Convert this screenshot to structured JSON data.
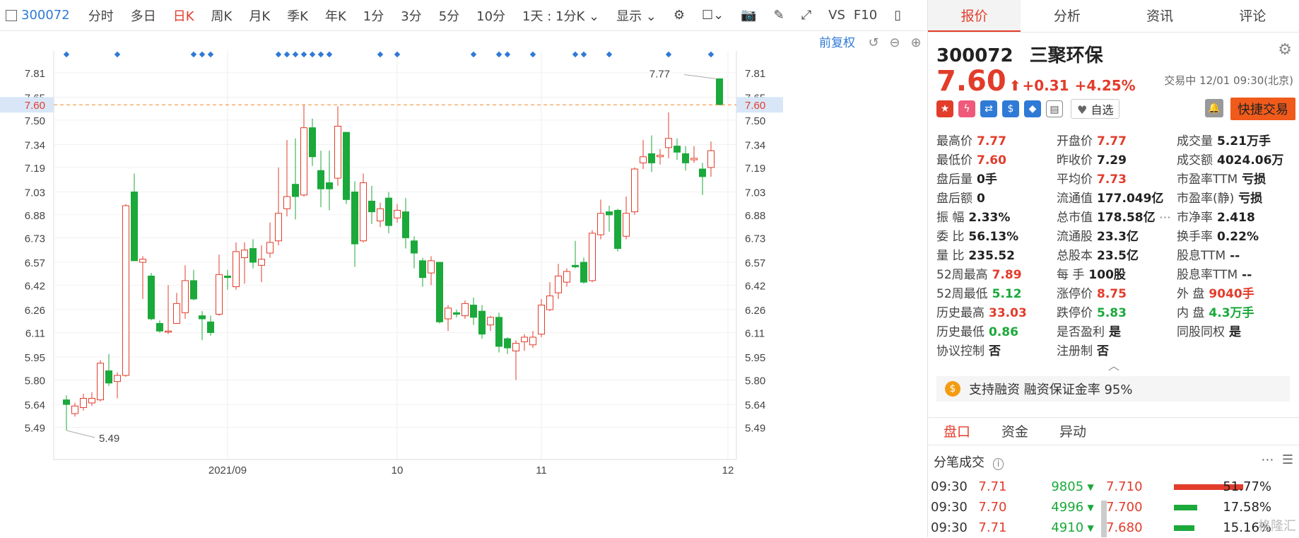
{
  "toolbar": {
    "code": "300072",
    "tabs": [
      "分时",
      "多日",
      "日K",
      "周K",
      "月K",
      "季K",
      "年K",
      "1分",
      "3分",
      "5分",
      "10分"
    ],
    "active_tab": "日K",
    "interval": "1天 : 1分K",
    "display": "显示",
    "vs": "VS",
    "f10": "F10"
  },
  "chart": {
    "fq_label": "前复权",
    "current_price_label": "7.60",
    "high_annot": "7.77",
    "low_annot": "5.49"
  },
  "chart_data": {
    "type": "candlestick",
    "y_ticks": [
      "7.81",
      "7.65",
      "7.50",
      "7.34",
      "7.19",
      "7.03",
      "6.88",
      "6.73",
      "6.57",
      "6.42",
      "6.26",
      "6.11",
      "5.95",
      "5.80",
      "5.64",
      "5.49"
    ],
    "ylim": [
      5.4,
      7.86
    ],
    "x_labels": [
      {
        "label": "2021/09",
        "index": 19
      },
      {
        "label": "10",
        "index": 39
      },
      {
        "label": "11",
        "index": 56
      },
      {
        "label": "12",
        "index": 78
      }
    ],
    "reference_line": 7.6,
    "candles": [
      [
        5.67,
        5.64,
        5.7,
        5.47
      ],
      [
        5.58,
        5.63,
        5.65,
        5.56
      ],
      [
        5.62,
        5.68,
        5.71,
        5.6
      ],
      [
        5.65,
        5.68,
        5.72,
        5.63
      ],
      [
        5.67,
        5.91,
        5.93,
        5.66
      ],
      [
        5.86,
        5.78,
        5.97,
        5.76
      ],
      [
        5.79,
        5.83,
        5.85,
        5.68
      ],
      [
        5.83,
        6.94,
        6.95,
        5.82
      ],
      [
        7.03,
        6.58,
        7.15,
        6.58
      ],
      [
        6.57,
        6.59,
        6.61,
        6.33
      ],
      [
        6.48,
        6.2,
        6.5,
        6.19
      ],
      [
        6.17,
        6.12,
        6.19,
        6.11
      ],
      [
        6.12,
        6.12,
        6.42,
        6.1
      ],
      [
        6.17,
        6.3,
        6.37,
        6.17
      ],
      [
        6.24,
        6.45,
        6.55,
        6.2
      ],
      [
        6.45,
        6.33,
        6.52,
        6.32
      ],
      [
        6.22,
        6.2,
        6.25,
        6.06
      ],
      [
        6.18,
        6.11,
        6.22,
        6.09
      ],
      [
        6.23,
        6.49,
        6.62,
        6.22
      ],
      [
        6.48,
        6.47,
        6.52,
        6.39
      ],
      [
        6.41,
        6.64,
        6.7,
        6.39
      ],
      [
        6.6,
        6.65,
        6.7,
        6.43
      ],
      [
        6.66,
        6.57,
        6.72,
        6.53
      ],
      [
        6.55,
        6.59,
        6.68,
        6.44
      ],
      [
        6.63,
        6.7,
        6.83,
        6.6
      ],
      [
        6.71,
        6.89,
        7.19,
        6.68
      ],
      [
        6.92,
        7.0,
        7.37,
        6.87
      ],
      [
        7.08,
        7.0,
        7.38,
        6.85
      ],
      [
        7.01,
        7.45,
        7.6,
        7.0
      ],
      [
        7.45,
        7.26,
        7.51,
        7.2
      ],
      [
        7.17,
        7.05,
        7.3,
        6.93
      ],
      [
        7.09,
        7.05,
        7.3,
        6.91
      ],
      [
        7.12,
        7.46,
        7.59,
        7.07
      ],
      [
        7.42,
        6.98,
        7.42,
        6.95
      ],
      [
        7.03,
        6.69,
        7.1,
        6.54
      ],
      [
        6.71,
        7.09,
        7.15,
        6.7
      ],
      [
        6.97,
        6.9,
        7.07,
        6.82
      ],
      [
        6.84,
        6.92,
        6.96,
        6.8
      ],
      [
        6.99,
        6.81,
        7.03,
        6.76
      ],
      [
        6.86,
        6.91,
        6.95,
        6.83
      ],
      [
        6.9,
        6.73,
        6.99,
        6.66
      ],
      [
        6.71,
        6.63,
        6.74,
        6.53
      ],
      [
        6.58,
        6.47,
        6.6,
        6.41
      ],
      [
        6.5,
        6.58,
        6.61,
        6.42
      ],
      [
        6.57,
        6.18,
        6.57,
        6.17
      ],
      [
        6.2,
        6.27,
        6.29,
        6.12
      ],
      [
        6.24,
        6.23,
        6.26,
        6.21
      ],
      [
        6.22,
        6.3,
        6.32,
        6.2
      ],
      [
        6.29,
        6.21,
        6.34,
        6.16
      ],
      [
        6.25,
        6.1,
        6.29,
        6.07
      ],
      [
        6.16,
        6.21,
        6.22,
        6.12
      ],
      [
        6.21,
        6.02,
        6.24,
        5.98
      ],
      [
        6.07,
        6.01,
        6.08,
        5.97
      ],
      [
        5.99,
        6.04,
        6.06,
        5.8
      ],
      [
        6.05,
        6.08,
        6.1,
        5.99
      ],
      [
        6.03,
        6.08,
        6.12,
        6.01
      ],
      [
        6.1,
        6.29,
        6.33,
        6.08
      ],
      [
        6.26,
        6.35,
        6.44,
        6.25
      ],
      [
        6.37,
        6.48,
        6.56,
        6.33
      ],
      [
        6.44,
        6.51,
        6.53,
        6.41
      ],
      [
        6.55,
        6.54,
        6.71,
        6.53
      ],
      [
        6.57,
        6.44,
        6.6,
        6.43
      ],
      [
        6.45,
        6.76,
        6.78,
        6.44
      ],
      [
        6.75,
        6.89,
        6.98,
        6.72
      ],
      [
        6.9,
        6.88,
        6.94,
        6.77
      ],
      [
        6.91,
        6.66,
        6.92,
        6.64
      ],
      [
        6.74,
        6.89,
        7.0,
        6.72
      ],
      [
        6.9,
        7.18,
        7.19,
        6.88
      ],
      [
        7.22,
        7.26,
        7.37,
        7.18
      ],
      [
        7.28,
        7.22,
        7.4,
        7.16
      ],
      [
        7.26,
        7.27,
        7.31,
        7.21
      ],
      [
        7.32,
        7.38,
        7.55,
        7.25
      ],
      [
        7.33,
        7.29,
        7.38,
        7.24
      ],
      [
        7.28,
        7.22,
        7.33,
        7.17
      ],
      [
        7.24,
        7.25,
        7.33,
        7.22
      ],
      [
        7.18,
        7.13,
        7.22,
        7.01
      ],
      [
        7.19,
        7.3,
        7.36,
        7.13
      ],
      [
        7.77,
        7.6,
        7.77,
        7.6
      ]
    ],
    "bullish_color": "#e23c2b",
    "bearish_color": "#1aa93a",
    "marker_color": "#2f7ad6",
    "marker_indices": [
      0,
      6,
      15,
      16,
      17,
      25,
      26,
      27,
      28,
      29,
      30,
      31,
      37,
      39,
      48,
      51,
      52,
      55,
      60,
      61,
      64,
      71,
      76
    ]
  },
  "right": {
    "tabs": [
      "报价",
      "分析",
      "资讯",
      "评论"
    ],
    "active_tab": "报价",
    "code": "300072",
    "name": "三聚环保",
    "price": "7.60",
    "arrow": "⬆",
    "change": "+0.31",
    "change_pct": "+4.25%",
    "trade_status": "交易中 12/01 09:30(北京)",
    "watch_label": "自选",
    "quick_trade": "快捷交易",
    "stats": [
      [
        {
          "k": "最高价",
          "v": "7.77",
          "c": "red"
        },
        {
          "k": "开盘价",
          "v": "7.77",
          "c": "red"
        },
        {
          "k": "成交量",
          "v": "5.21万手",
          "c": "blk"
        }
      ],
      [
        {
          "k": "最低价",
          "v": "7.60",
          "c": "red"
        },
        {
          "k": "昨收价",
          "v": "7.29",
          "c": "blk"
        },
        {
          "k": "成交额",
          "v": "4024.06万",
          "c": "blk"
        }
      ],
      [
        {
          "k": "盘后量",
          "v": "0手",
          "c": "blk"
        },
        {
          "k": "平均价",
          "v": "7.73",
          "c": "red"
        },
        {
          "k": "市盈率TTM",
          "v": "亏损",
          "c": "blk"
        }
      ],
      [
        {
          "k": "盘后额",
          "v": "0",
          "c": "blk"
        },
        {
          "k": "流通值",
          "v": "177.049亿",
          "c": "blk"
        },
        {
          "k": "市盈率(静)",
          "v": "亏损",
          "c": "blk"
        }
      ],
      [
        {
          "k": "振 幅",
          "v": "2.33%",
          "c": "blk"
        },
        {
          "k": "总市值",
          "v": "178.58亿",
          "c": "blk"
        },
        {
          "k": "市净率",
          "v": "2.418",
          "c": "blk"
        }
      ],
      [
        {
          "k": "委 比",
          "v": "56.13%",
          "c": "blk"
        },
        {
          "k": "流通股",
          "v": "23.3亿",
          "c": "blk"
        },
        {
          "k": "换手率",
          "v": "0.22%",
          "c": "blk"
        }
      ],
      [
        {
          "k": "量 比",
          "v": "235.52",
          "c": "blk"
        },
        {
          "k": "总股本",
          "v": "23.5亿",
          "c": "blk"
        },
        {
          "k": "股息TTM",
          "v": "--",
          "c": "blk"
        }
      ],
      [
        {
          "k": "52周最高",
          "v": "7.89",
          "c": "red"
        },
        {
          "k": "每 手",
          "v": "100股",
          "c": "blk"
        },
        {
          "k": "股息率TTM",
          "v": "--",
          "c": "blk"
        }
      ],
      [
        {
          "k": "52周最低",
          "v": "5.12",
          "c": "green"
        },
        {
          "k": "涨停价",
          "v": "8.75",
          "c": "red"
        },
        {
          "k": "外 盘",
          "v": "9040手",
          "c": "red"
        }
      ],
      [
        {
          "k": "历史最高",
          "v": "33.03",
          "c": "red"
        },
        {
          "k": "跌停价",
          "v": "5.83",
          "c": "green"
        },
        {
          "k": "内 盘",
          "v": "4.3万手",
          "c": "green"
        }
      ],
      [
        {
          "k": "历史最低",
          "v": "0.86",
          "c": "green"
        },
        {
          "k": "是否盈利",
          "v": "是",
          "c": "blk"
        },
        {
          "k": "同股同权",
          "v": "是",
          "c": "blk"
        }
      ],
      [
        {
          "k": "协议控制",
          "v": "否",
          "c": "blk"
        },
        {
          "k": "注册制",
          "v": "否",
          "c": "blk"
        },
        {
          "k": "",
          "v": "",
          "c": "blk"
        }
      ]
    ],
    "margin": "支持融资 融资保证金率 95%",
    "sub_tabs": [
      "盘口",
      "资金",
      "异动"
    ],
    "fb_title": "分笔成交",
    "ticks": [
      {
        "t": "09:30",
        "p": "7.71",
        "v": "9805"
      },
      {
        "t": "09:30",
        "p": "7.70",
        "v": "4996"
      },
      {
        "t": "09:30",
        "p": "7.71",
        "v": "4910"
      }
    ],
    "dist": [
      {
        "p": "7.710",
        "pct": "51.77%",
        "frac": 0.5177,
        "color": "#e23c2b"
      },
      {
        "p": "7.700",
        "pct": "17.58%",
        "frac": 0.1758,
        "color": "#1aa93a"
      },
      {
        "p": "7.680",
        "pct": "15.16%",
        "frac": 0.1516,
        "color": "#1aa93a"
      }
    ],
    "watermark": "格隆汇"
  }
}
